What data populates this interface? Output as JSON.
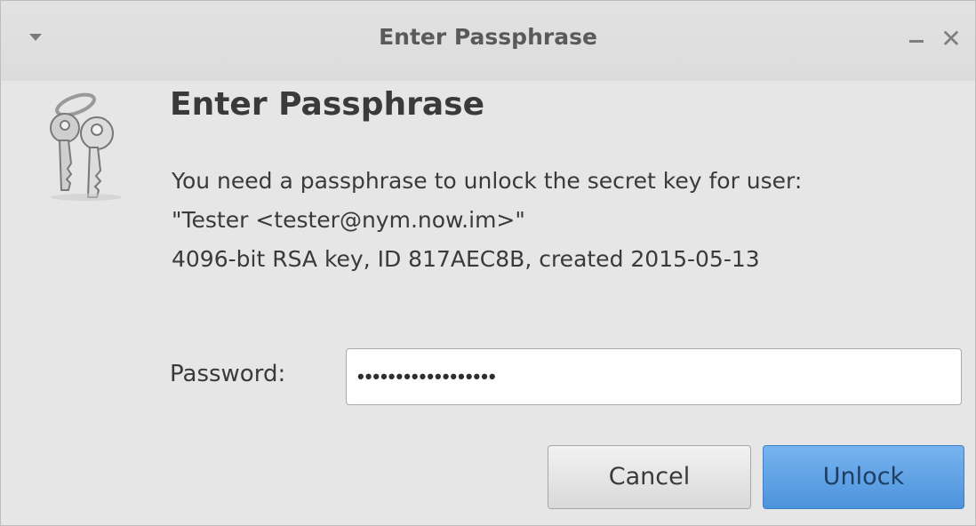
{
  "window": {
    "title": "Enter Passphrase",
    "controls": {
      "minimize_symbol": "–",
      "close_symbol": "✕"
    }
  },
  "dialog": {
    "icon": "keys-icon",
    "heading": "Enter Passphrase",
    "message_lines": [
      "You need a passphrase to unlock the secret key for user:",
      "\"Tester <tester@nym.now.im>\"",
      "4096-bit RSA key, ID 817AEC8B, created 2015-05-13"
    ],
    "password": {
      "label": "Password:",
      "value": "••••••••••••••••••"
    },
    "buttons": {
      "cancel": "Cancel",
      "unlock": "Unlock"
    }
  },
  "colors": {
    "accent": "#5a9de3",
    "window_bg": "#e6e6e6",
    "text": "#3a3a3a"
  }
}
